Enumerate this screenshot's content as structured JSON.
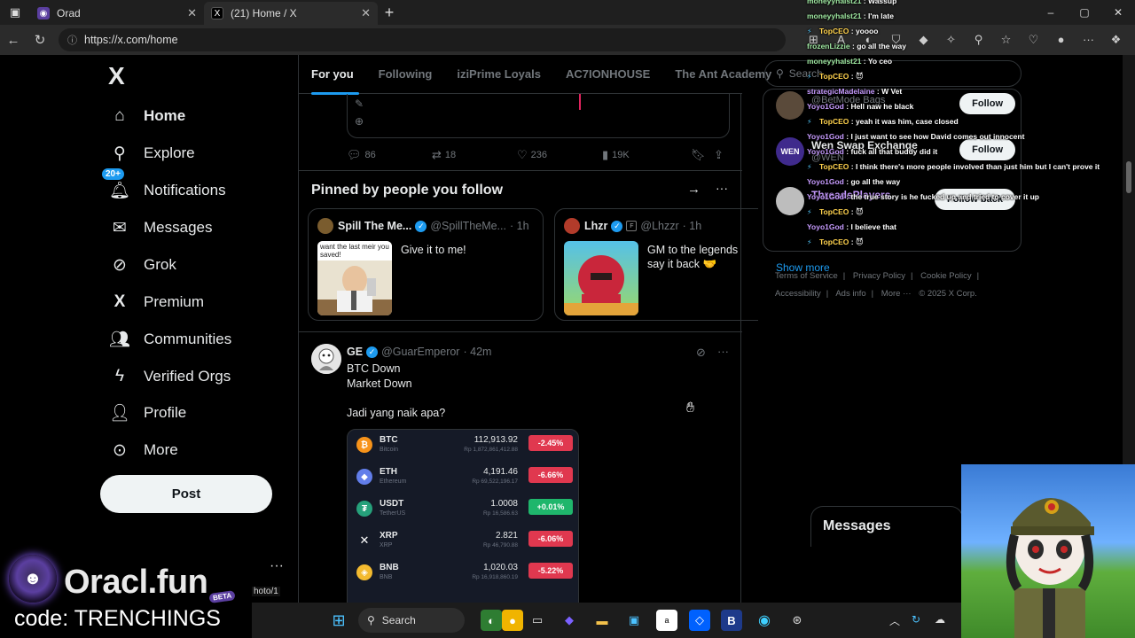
{
  "browser": {
    "tabs": [
      {
        "title": "Orad",
        "active": false
      },
      {
        "title": "(21) Home / X",
        "active": true
      }
    ],
    "new_tab": "+",
    "url": "https://x.com/home",
    "window_controls": [
      "–",
      "▢",
      "✕"
    ]
  },
  "nav": {
    "logo": "X",
    "notification_badge": "20+",
    "items": [
      {
        "label": "Home",
        "icon": "home-icon"
      },
      {
        "label": "Explore",
        "icon": "search-icon"
      },
      {
        "label": "Notifications",
        "icon": "bell-icon"
      },
      {
        "label": "Messages",
        "icon": "mail-icon"
      },
      {
        "label": "Grok",
        "icon": "grok-icon"
      },
      {
        "label": "Premium",
        "icon": "x-icon"
      },
      {
        "label": "Communities",
        "icon": "people-icon"
      },
      {
        "label": "Verified Orgs",
        "icon": "lightning-icon"
      },
      {
        "label": "Profile",
        "icon": "person-icon"
      },
      {
        "label": "More",
        "icon": "more-circle-icon"
      }
    ],
    "post_label": "Post"
  },
  "feed": {
    "tabs": [
      "For you",
      "Following",
      "iziPrime Loyals",
      "AC7IONHOUSE",
      "The Ant Academy"
    ],
    "prev_actions": {
      "replies": "86",
      "reposts": "18",
      "likes": "236",
      "views": "19K"
    },
    "pinned_title": "Pinned by people you follow",
    "pinned": [
      {
        "name": "Spill The Me...",
        "handle": "@SpillTheMe...",
        "time": "· 1h",
        "text": "Give it to me!",
        "meme_text": "want the last meir you saved!"
      },
      {
        "name": "Lhzr",
        "handle": "@Lhzzr",
        "time": "· 1h",
        "text": "GM to the legends say it back 🤝"
      }
    ],
    "tweet": {
      "name": "GE",
      "handle": "@GuarEmperor",
      "time": "· 42m",
      "body": "BTC Down\nMarket Down\n\nJadi yang naik apa?",
      "prices": [
        {
          "symbol": "BTC",
          "name": "Bitcoin",
          "price": "112,913.92",
          "rp": "Rp 1,872,861,412.88",
          "change": "-2.45%",
          "color": "#f7931a",
          "up": false
        },
        {
          "symbol": "ETH",
          "name": "Ethereum",
          "price": "4,191.46",
          "rp": "Rp 69,522,196.17",
          "change": "-6.66%",
          "color": "#627eea",
          "up": false
        },
        {
          "symbol": "USDT",
          "name": "TetherUS",
          "price": "1.0008",
          "rp": "Rp 16,586.63",
          "change": "+0.01%",
          "color": "#26a17b",
          "up": true
        },
        {
          "symbol": "XRP",
          "name": "XRP",
          "price": "2.821",
          "rp": "Rp 46,790.88",
          "change": "-6.06%",
          "color": "#23292f",
          "up": false
        },
        {
          "symbol": "BNB",
          "name": "BNB",
          "price": "1,020.03",
          "rp": "Rp 16,918,860.19",
          "change": "-5.22%",
          "color": "#f3ba2f",
          "up": false
        }
      ]
    }
  },
  "sidebar": {
    "search_placeholder": "Search",
    "who_to_follow": [
      {
        "name": "",
        "handle": "@BetMode Bags",
        "button": "Follow"
      },
      {
        "name": "Wen Swap Exchange",
        "handle": "@WEN",
        "button": "Follow"
      },
      {
        "name": "ThreadsPlayers",
        "handle": "",
        "button": "Follow back"
      }
    ],
    "show_more": "Show more",
    "footer": [
      "Terms of Service",
      "|",
      "Privacy Policy",
      "|",
      "Cookie Policy",
      "|",
      "Accessibility",
      "|",
      "Ads info",
      "|",
      "More ···",
      "© 2025 X Corp."
    ]
  },
  "chat": [
    {
      "user": "moneyyhalst21",
      "msg": "Wassup",
      "color": "green"
    },
    {
      "user": "moneyyhalst21",
      "msg": "I'm late",
      "color": "green"
    },
    {
      "user": "TopCEO",
      "msg": "yoooo",
      "color": "gold",
      "tag": true
    },
    {
      "user": "frozenLizzie",
      "msg": "go all the way",
      "color": "green"
    },
    {
      "user": "moneyyhalst21",
      "msg": "Yo ceo",
      "color": "green"
    },
    {
      "user": "TopCEO",
      "msg": "😈",
      "color": "gold",
      "tag": true
    },
    {
      "user": "strategicMadelaine",
      "msg": "W Vet",
      "color": "purple"
    },
    {
      "user": "Yoyo1God",
      "msg": "Hell naw he black",
      "color": "purple"
    },
    {
      "user": "TopCEO",
      "msg": "yeah it was him, case closed",
      "color": "gold",
      "tag": true
    },
    {
      "user": "Yoyo1God",
      "msg": "I just want to see how David comes out innocent",
      "color": "purple"
    },
    {
      "user": "Yoyo1God",
      "msg": "fuck all that buddy did it",
      "color": "purple"
    },
    {
      "user": "TopCEO",
      "msg": "I think there's more people involved than just him but I can't prove it",
      "color": "gold",
      "tag": true
    },
    {
      "user": "Yoyo1God",
      "msg": "go all the way",
      "color": "purple"
    },
    {
      "user": "Yoyo1God",
      "msg": "the true story is he fucked up and tried to cover it up",
      "color": "purple"
    },
    {
      "user": "TopCEO",
      "msg": "😈",
      "color": "gold",
      "tag": true
    },
    {
      "user": "Yoyo1God",
      "msg": "I believe that",
      "color": "purple"
    },
    {
      "user": "TopCEO",
      "msg": "😈",
      "color": "gold",
      "tag": true
    }
  ],
  "messages_label": "Messages",
  "taskbar": {
    "search_label": "Search"
  },
  "overlay": {
    "brand": "Oracl.fun",
    "beta": "BETA",
    "code": "code: TRENCHINGS",
    "photo_label": "hoto/1"
  }
}
